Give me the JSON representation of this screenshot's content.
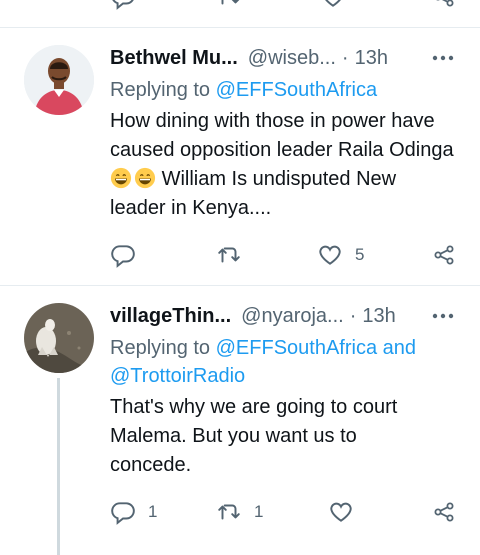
{
  "tweets": [
    {
      "name": "Bethwel Mu...",
      "handle": "@wiseb...",
      "dot": "·",
      "time": "13h",
      "reply_prefix": "Replying to",
      "reply_to": "@EFFSouthAfrica",
      "text_part1": "How dining with those in power have caused opposition leader Raila Odinga",
      "emoji": "grinning-face-emoji",
      "text_part2": "William Is undisputed New leader in Kenya....",
      "replies": "",
      "retweets": "",
      "likes": "5"
    },
    {
      "name": "villageThin...",
      "handle": "@nyaroja...",
      "dot": "·",
      "time": "13h",
      "reply_prefix": "Replying to",
      "reply_to": "@EFFSouthAfrica and @TrottoirRadio",
      "text": "That's why we are going to court Malema. But you want us to concede.",
      "replies": "1",
      "retweets": "1",
      "likes": ""
    }
  ],
  "icons": {
    "reply": "reply-icon",
    "retweet": "retweet-icon",
    "like": "heart-icon",
    "share": "share-icon",
    "more": "more-icon"
  },
  "colors": {
    "link": "#1d9bf0",
    "muted": "#536471",
    "text": "#0f1419",
    "separator": "#e6ecf0"
  }
}
